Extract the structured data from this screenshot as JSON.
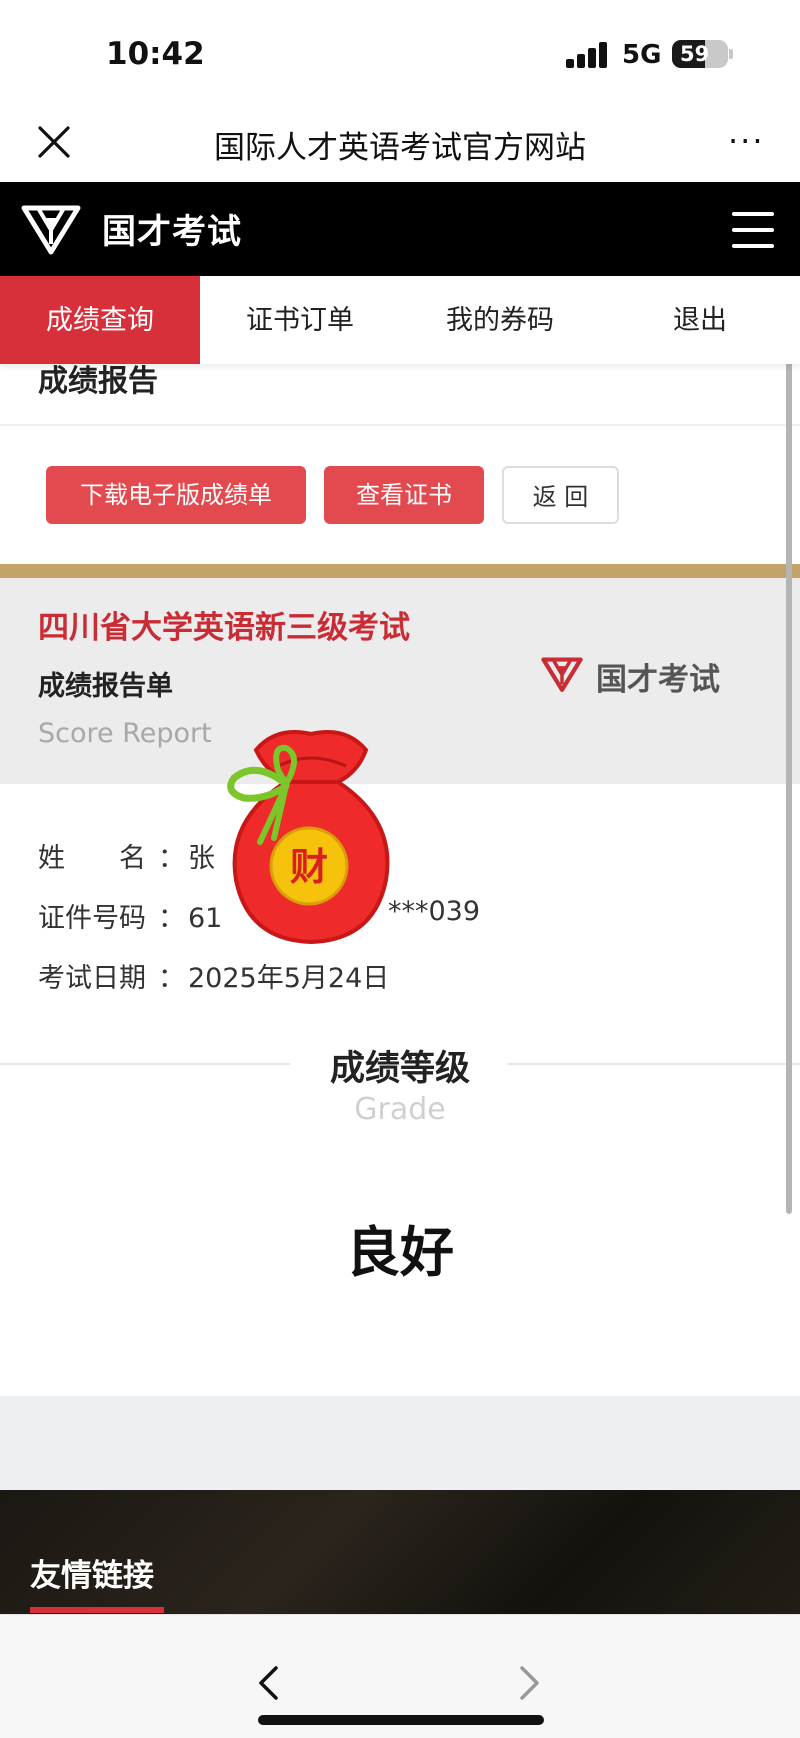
{
  "status_bar": {
    "time": "10:42",
    "network": "5G",
    "battery": "59",
    "battery_level": 0.59
  },
  "nav_bar": {
    "title": "国际人才英语考试官方网站",
    "more": "···"
  },
  "site_header": {
    "logo_text": "国才考试"
  },
  "tabs": [
    {
      "label": "成绩查询",
      "active": true
    },
    {
      "label": "证书订单",
      "active": false
    },
    {
      "label": "我的券码",
      "active": false
    },
    {
      "label": "退出",
      "active": false
    }
  ],
  "section_title": "成绩报告",
  "actions": {
    "download": "下载电子版成绩单",
    "view_certificate": "查看证书",
    "back": "返 回"
  },
  "report": {
    "exam_name": "四川省大学英语新三级考试",
    "title": "成绩报告单",
    "title_en": "Score Report",
    "logo_text": "国才考试"
  },
  "info": {
    "name_label": "姓　　名",
    "name_value": "张",
    "id_label": "证件号码",
    "id_value": "61",
    "id_suffix": "***039",
    "date_label": "考试日期",
    "date_value": "2025年5月24日",
    "colon": "："
  },
  "grade": {
    "label_cn": "成绩等级",
    "label_en": "Grade",
    "value": "良好"
  },
  "sticker": {
    "char": "财"
  },
  "footer": {
    "title": "友情链接"
  },
  "colors": {
    "brand_red": "#d8303b",
    "button_red": "#e24a4f",
    "gold": "#c4a36a"
  }
}
